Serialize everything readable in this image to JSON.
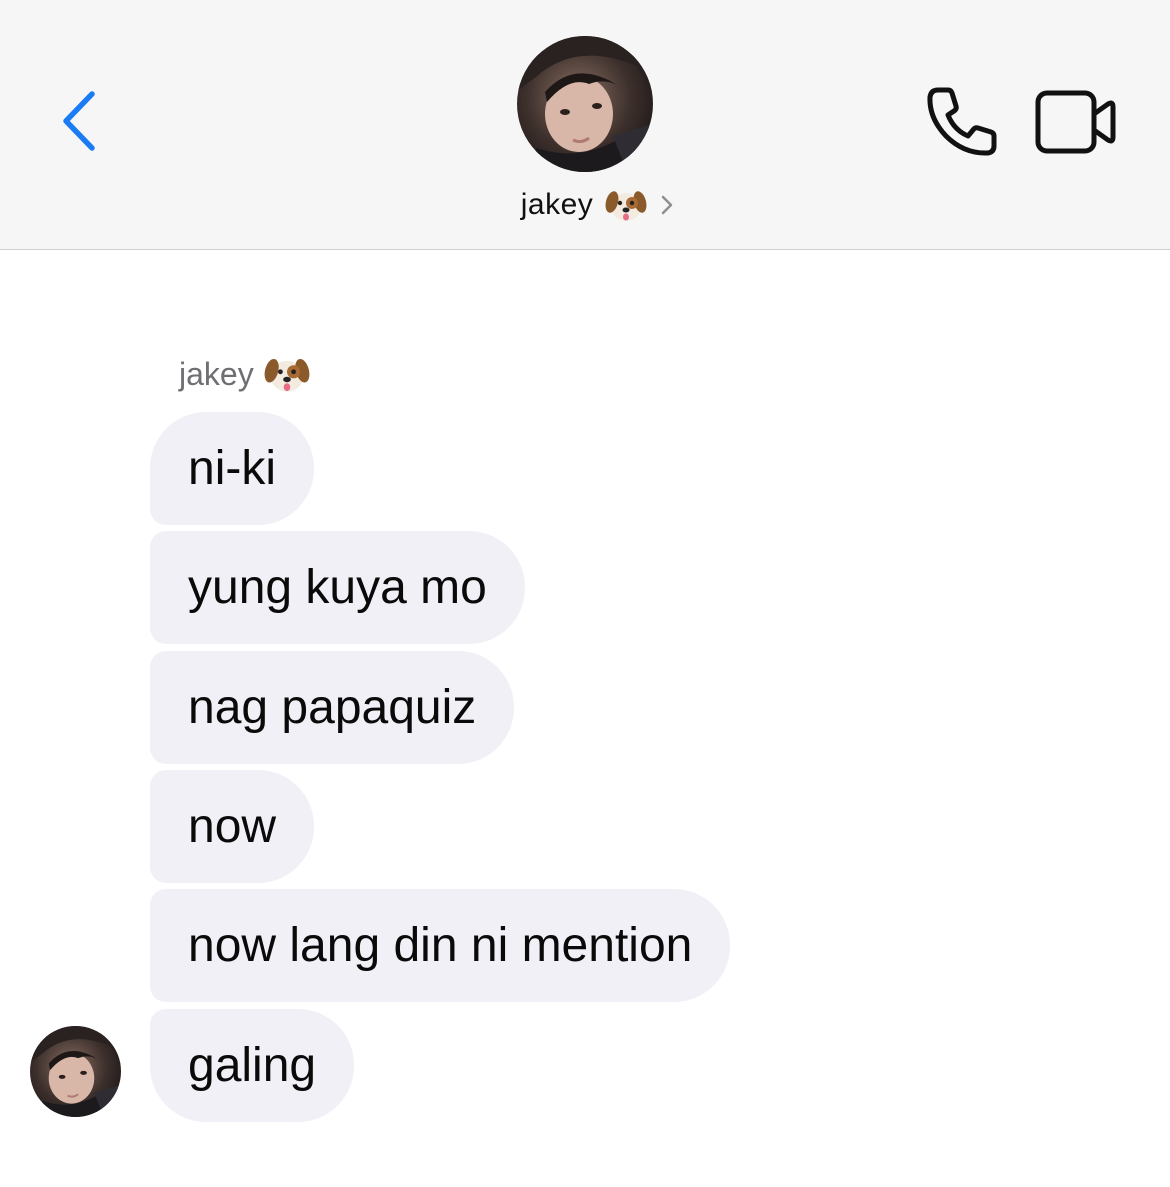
{
  "header": {
    "contact_name": "jakey",
    "contact_emoji_icon": "dog-face-icon",
    "back_icon": "chevron-left-icon",
    "call_icon": "phone-icon",
    "video_icon": "video-camera-icon",
    "accent_color": "#1a7cf5"
  },
  "thread": {
    "sender_label": "jakey",
    "sender_emoji_icon": "dog-face-icon",
    "bubble_color": "#f0f0f6",
    "messages": [
      "ni-ki",
      "yung kuya mo",
      "nag papaquiz",
      "now",
      "now lang din ni mention",
      "galing"
    ]
  }
}
